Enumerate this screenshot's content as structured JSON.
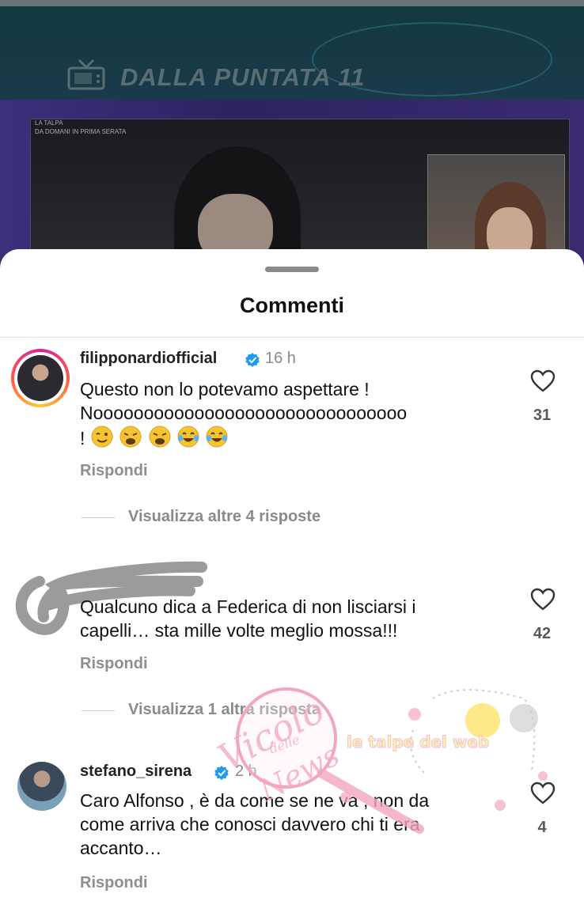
{
  "video": {
    "banner_text": "DALLA PUNTATA 11",
    "small_tag_line1": "LA TALPA",
    "small_tag_line2": "DA DOMANI IN PRIMA SERATA"
  },
  "sheet": {
    "title": "Commenti"
  },
  "comments": [
    {
      "username": "filipponardiofficial",
      "verified": true,
      "time": "16 h",
      "text_line1": "Questo non lo potevamo aspettare !",
      "text_line2": "Nooooooooooooooooooooooooooooooo",
      "text_line3_prefix": "!",
      "emojis": [
        "winking-face",
        "weary-face",
        "weary-face",
        "tears-of-joy",
        "tears-of-joy"
      ],
      "likes": "31",
      "reply_label": "Rispondi",
      "more_replies": "Visualizza altre 4 risposte"
    },
    {
      "username": "",
      "text_line1": "Qualcuno dica a Federica di non lisciarsi i",
      "text_line2": "capelli… sta mille volte meglio mossa!!!",
      "likes": "42",
      "reply_label": "Rispondi",
      "more_replies": "Visualizza 1 altra risposta"
    },
    {
      "username": "stefano_sirena",
      "verified": true,
      "time": "2 h",
      "text_line1": "Caro Alfonso , è da come se ne va , non da",
      "text_line2": "come arriva che conosci davvero chi ti era",
      "text_line3": "accanto…",
      "likes": "4",
      "reply_label": "Rispondi"
    }
  ],
  "watermark": {
    "main": "Vicolo",
    "small": "delle",
    "sub": "News",
    "tagline": "le talpe del web"
  },
  "colors": {
    "verified": "#1d9bf0",
    "watermark_pink": "#f2a6c0"
  }
}
